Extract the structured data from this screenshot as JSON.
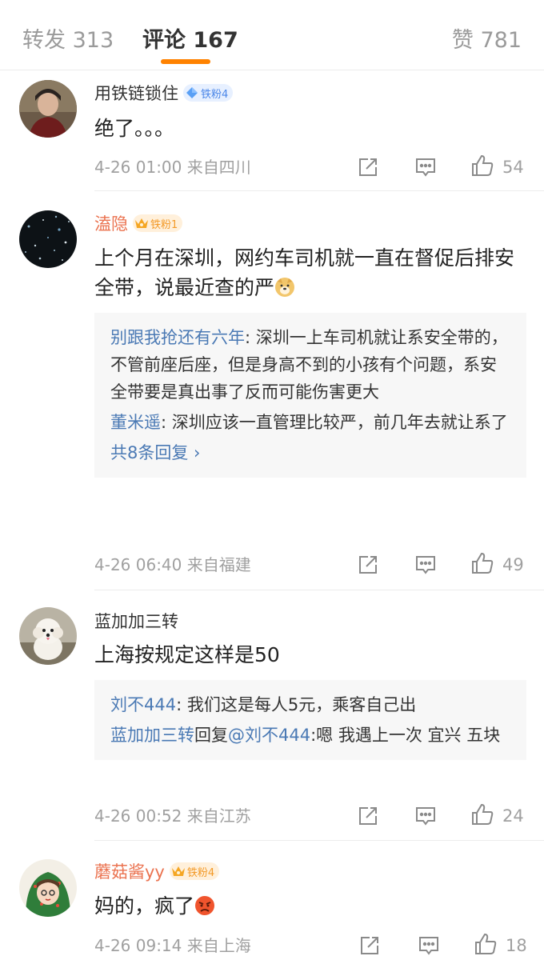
{
  "tabs": {
    "repost": "转发 313",
    "comments": "评论 167",
    "likes": "赞 781"
  },
  "colors": {
    "accent": "#ff8200",
    "vip_name": "#eb7350",
    "link": "#4a79b4",
    "meta": "#a0a0a0"
  },
  "comments": [
    {
      "user": "用铁链锁住",
      "badge": "铁粉4",
      "text": "绝了。。。",
      "time": "4-26 01:00",
      "location": "来自四川",
      "likes": "54"
    },
    {
      "user": "溘隐",
      "badge": "铁粉1",
      "text": "上个月在深圳，网约车司机就一直在督促后排安全带，说最近查的严",
      "replies": [
        {
          "name": "别跟我抢还有六年",
          "text": ": 深圳一上车司机就让系安全带的，不管前座后座，但是身高不到的小孩有个问题，系安全带要是真出事了反而可能伤害更大"
        },
        {
          "name": "董米遥",
          "text": ": 深圳应该一直管理比较严，前几年去就让系了"
        }
      ],
      "more": "共8条回复 ›",
      "time": "4-26 06:40",
      "location": "来自福建",
      "likes": "49"
    },
    {
      "user": "蓝加加三转",
      "text": "上海按规定这样是50",
      "replies": [
        {
          "name": "刘不444",
          "text": ": 我们这是每人5元，乘客自己出"
        },
        {
          "name": "蓝加加三转",
          "mid": "回复",
          "at": "@刘不444",
          "text": ":嗯 我遇上一次 宜兴 五块"
        }
      ],
      "time": "4-26 00:52",
      "location": "来自江苏",
      "likes": "24"
    },
    {
      "user": "蘑菇酱yy",
      "badge": "铁粉4",
      "text": "妈的，疯了",
      "time": "4-26 09:14",
      "location": "来自上海",
      "likes": "18"
    }
  ]
}
